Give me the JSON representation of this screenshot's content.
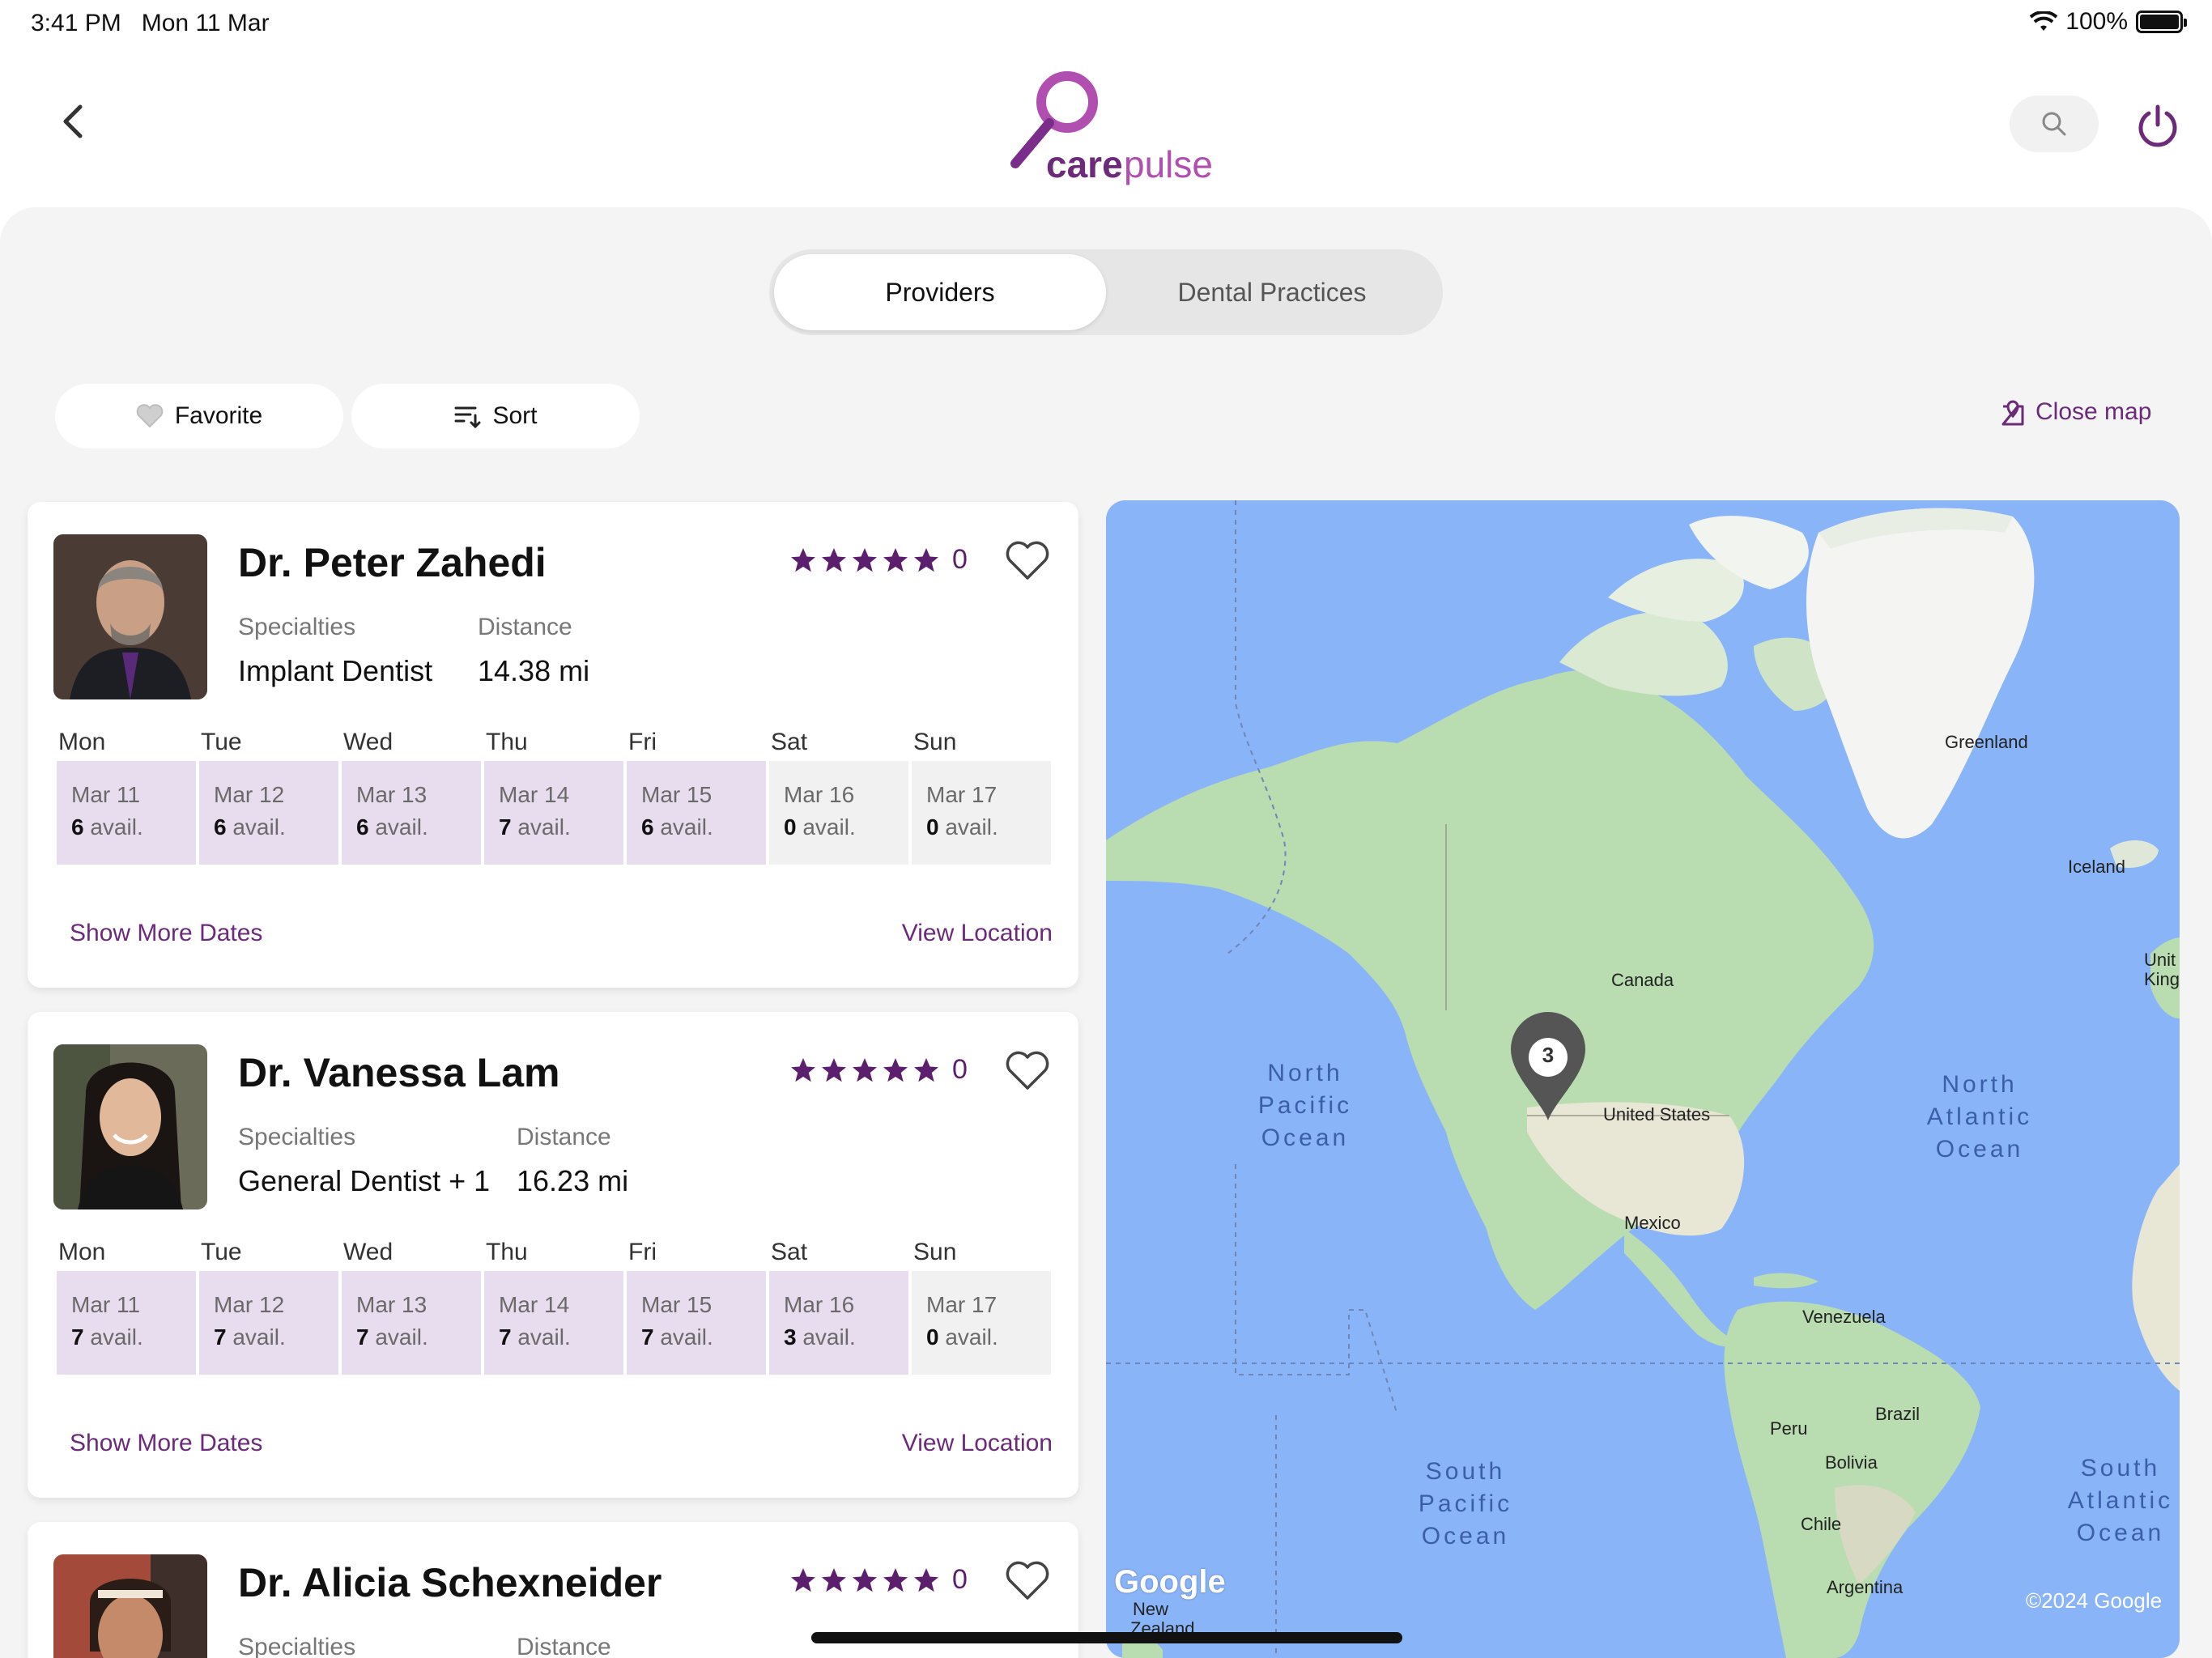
{
  "status_bar": {
    "time": "3:41 PM",
    "date": "Mon 11 Mar",
    "battery": "100%"
  },
  "header": {
    "logo_care": "care",
    "logo_pulse": "pulse"
  },
  "tabs": [
    {
      "label": "Providers",
      "active": true
    },
    {
      "label": "Dental Practices",
      "active": false
    }
  ],
  "filters": {
    "favorite": "Favorite",
    "sort": "Sort",
    "close_map": "Close map"
  },
  "providers": [
    {
      "name": "Dr. Peter Zahedi",
      "rating_count": "0",
      "specialties_label": "Specialties",
      "specialties": "Implant Dentist",
      "distance_label": "Distance",
      "distance": "14.38 mi",
      "days": [
        {
          "day": "Mon",
          "date": "Mar 11",
          "count": "6",
          "avail": "avail."
        },
        {
          "day": "Tue",
          "date": "Mar 12",
          "count": "6",
          "avail": "avail."
        },
        {
          "day": "Wed",
          "date": "Mar 13",
          "count": "6",
          "avail": "avail."
        },
        {
          "day": "Thu",
          "date": "Mar 14",
          "count": "7",
          "avail": "avail."
        },
        {
          "day": "Fri",
          "date": "Mar 15",
          "count": "6",
          "avail": "avail."
        },
        {
          "day": "Sat",
          "date": "Mar 16",
          "count": "0",
          "avail": "avail."
        },
        {
          "day": "Sun",
          "date": "Mar 17",
          "count": "0",
          "avail": "avail."
        }
      ],
      "show_more": "Show More Dates",
      "view_location": "View Location"
    },
    {
      "name": "Dr. Vanessa Lam",
      "rating_count": "0",
      "specialties_label": "Specialties",
      "specialties": "General Dentist + 1",
      "distance_label": "Distance",
      "distance": "16.23 mi",
      "days": [
        {
          "day": "Mon",
          "date": "Mar 11",
          "count": "7",
          "avail": "avail."
        },
        {
          "day": "Tue",
          "date": "Mar 12",
          "count": "7",
          "avail": "avail."
        },
        {
          "day": "Wed",
          "date": "Mar 13",
          "count": "7",
          "avail": "avail."
        },
        {
          "day": "Thu",
          "date": "Mar 14",
          "count": "7",
          "avail": "avail."
        },
        {
          "day": "Fri",
          "date": "Mar 15",
          "count": "7",
          "avail": "avail."
        },
        {
          "day": "Sat",
          "date": "Mar 16",
          "count": "3",
          "avail": "avail."
        },
        {
          "day": "Sun",
          "date": "Mar 17",
          "count": "0",
          "avail": "avail."
        }
      ],
      "show_more": "Show More Dates",
      "view_location": "View Location"
    },
    {
      "name": "Dr. Alicia Schexneider",
      "rating_count": "0",
      "specialties_label": "Specialties",
      "distance_label": "Distance"
    }
  ],
  "map": {
    "labels": {
      "greenland": "Greenland",
      "iceland": "Iceland",
      "uk": "Unit Kingd",
      "canada": "Canada",
      "us": "United States",
      "mexico": "Mexico",
      "venezuela": "Venezuela",
      "peru": "Peru",
      "brazil": "Brazil",
      "bolivia": "Bolivia",
      "chile": "Chile",
      "argentina": "Argentina",
      "new_zealand": "New Zealand"
    },
    "oceans": {
      "north_pacific": "North Pacific Ocean",
      "north_atlantic": "North Atlantic Ocean",
      "south_pacific": "South Pacific Ocean",
      "south_atlantic": "South Atlantic Ocean"
    },
    "marker_count": "3",
    "google": "Google",
    "copyright": "©2024 Google"
  },
  "colors": {
    "brand": "#6b2a7a",
    "slot_available": "#e8dcef",
    "slot_empty": "#f1f1f1",
    "water": "#8ab4f8",
    "land": "#b9dcb0"
  }
}
